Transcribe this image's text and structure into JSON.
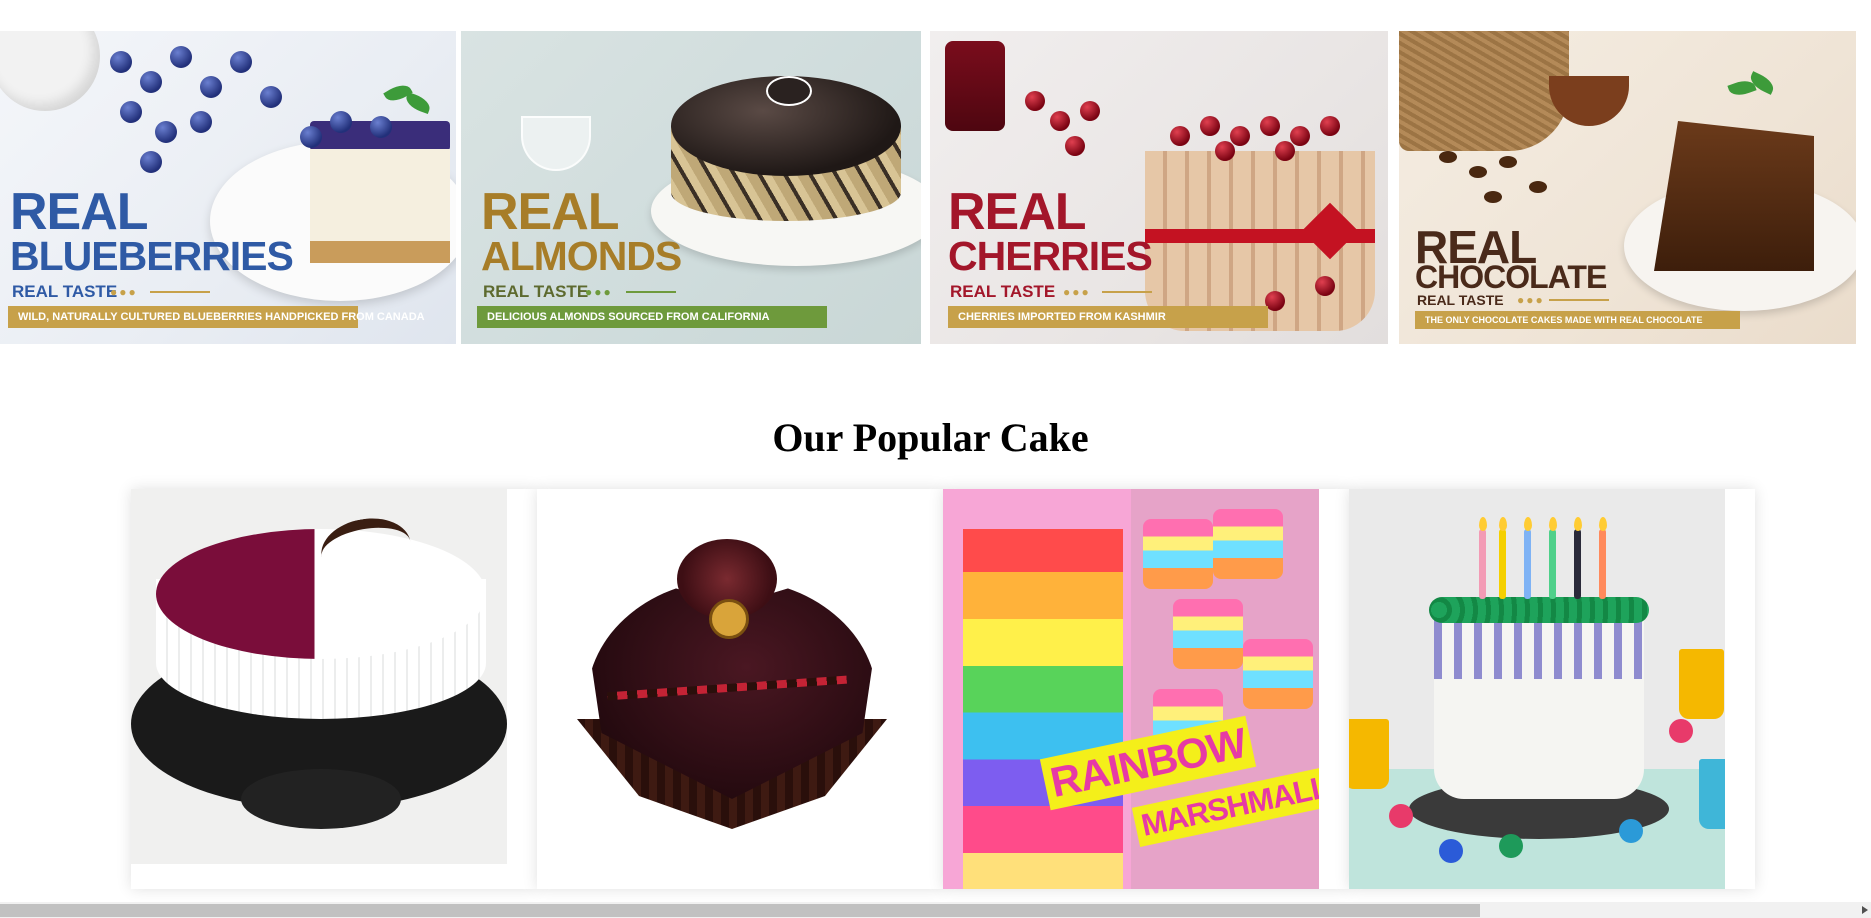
{
  "banners": [
    {
      "real": "REAL",
      "name": "BLUEBERRIES",
      "taste": "REAL TASTE",
      "ribbon": "WILD, NATURALLY CULTURED BLUEBERRIES HANDPICKED FROM CANADA"
    },
    {
      "real": "REAL",
      "name": "ALMONDS",
      "taste": "REAL TASTE",
      "ribbon": "DELICIOUS ALMONDS SOURCED FROM CALIFORNIA"
    },
    {
      "real": "REAL",
      "name": "CHERRIES",
      "taste": "REAL TASTE",
      "ribbon": "CHERRIES IMPORTED FROM KASHMIR"
    },
    {
      "real": "REAL",
      "name": "CHOCOLATE",
      "taste": "REAL TASTE",
      "ribbon": "THE ONLY CHOCOLATE CAKES MADE WITH REAL CHOCOLATE"
    }
  ],
  "section": {
    "title": "Our Popular Cake"
  },
  "cards": [
    {
      "icon": "blueberry-cheesecake-image"
    },
    {
      "icon": "heart-chocolate-cake-image"
    },
    {
      "icon": "rainbow-marshmallows-image",
      "tag1": "RAINBOW",
      "tag2": "MARSHMALLOWS"
    },
    {
      "icon": "birthday-drip-cake-image"
    }
  ],
  "colors": {
    "blueberry": "#2f5aa5",
    "almond": "#a77d28",
    "cherry": "#a3162a",
    "chocolate": "#4a2a1a",
    "gold_ribbon": "#c7a14a",
    "green_ribbon": "#6e9a3c"
  }
}
